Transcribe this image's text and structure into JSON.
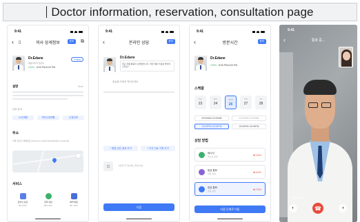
{
  "banner": {
    "title": "Doctor information, reservation, consultation page"
  },
  "status_time": "9:41",
  "screen1": {
    "title": "의사 상세정보",
    "tag": "문의",
    "doctor_name": "Dr.Edane",
    "doctor_sub": "재활의학과 전문의",
    "follow": "Follow",
    "rating": "100%",
    "hours": "8:00 PM-6:00 PM",
    "intro_title": "설명",
    "more": "More",
    "specialty_title": "진료 분야",
    "chips": [
      "노인재활",
      "척추신경재활",
      "신경내과"
    ],
    "address_title": "주소",
    "address": "서울 강남구 테헤란로 (Sincheon Health Rehabilitation Hospital)",
    "service_title": "서비스",
    "services": [
      {
        "label": "온라인 상담",
        "price": "₩ 3,000"
      },
      {
        "label": "전화 상담",
        "price": "₩ 6,000"
      },
      {
        "label": "예약 방문",
        "price": "₩ 7,000"
      }
    ]
  },
  "screen2": {
    "title": "온라인 상담",
    "tag": "문의",
    "doctor_name": "Dr.Edane",
    "question": "최근 무릎 통증이 심해졌습니다. 어떤 재활 치료를 받아야 할까요?",
    "hint": "증상을 자세히 적어주세요",
    "pill_left": "+ 병원 검진 결과 추가",
    "pill_right": "+ 이전 진료 기록 추가",
    "upload_hint": "사진을 추가하세요 (최대 5장)",
    "cta": "다음"
  },
  "screen3": {
    "title": "방문시간",
    "tag": "문의",
    "doctor_name": "Dr.Edane",
    "rating": "100%",
    "hours": "8:00 PM-6:00 PM",
    "schedule_title": "스케줄",
    "days": [
      {
        "dn": "Sun",
        "dd": "23"
      },
      {
        "dn": "Mon",
        "dd": "24"
      },
      {
        "dn": "Wed",
        "dd": "26"
      },
      {
        "dn": "Thu",
        "dd": "27"
      },
      {
        "dn": "Fri",
        "dd": "28"
      }
    ],
    "slots": [
      "09:00AM-10:00AM",
      "10:00AM-11:00AM",
      "13:00PM-15:00PM",
      "15:00PM-16:00PM"
    ],
    "method_title": "상담 방법",
    "methods": [
      {
        "title": "메시지",
        "sub": "텍스트 상담",
        "price": "₩ 3000"
      },
      {
        "title": "음성 통화",
        "sub": "전화 상담",
        "price": "₩ 6000"
      },
      {
        "title": "영상 통화",
        "sub": "화상 상담",
        "price": "₩ 7000"
      }
    ],
    "cta": "다음 단계로 이동"
  },
  "screen4": {
    "title": "통화 중...",
    "name": "Dr.Edane"
  },
  "colors": {
    "accent": "#3f79f5",
    "end_call": "#e64b3c",
    "green": "#3bb26b"
  }
}
